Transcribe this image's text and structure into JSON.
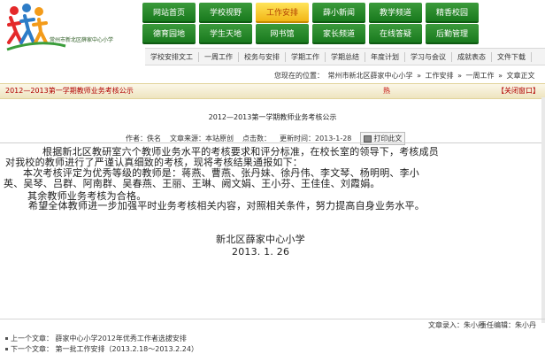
{
  "header": {
    "logo_text": "常州市新北区薛家中心小学",
    "nav_row1": [
      "网站首页",
      "学校视野",
      "工作安排",
      "薛小新闻",
      "教学频道",
      "精香校园"
    ],
    "nav_row1_active_index": 2,
    "nav_row2": [
      "德育园地",
      "学生天地",
      "网书馆",
      "家长频道",
      "在线答疑",
      "后勤管理"
    ],
    "subnav": [
      "学校安排文工",
      "一周工作",
      "校务与安排",
      "学期工作",
      "学期总结",
      "年度计划",
      "学习与会议",
      "成就表态",
      "文件下载"
    ]
  },
  "breadcrumb": {
    "prefix": "您现在的位置：",
    "items": [
      "常州市新北区薛家中心小学",
      "工作安排",
      "一周工作",
      "文章正文"
    ]
  },
  "titlebar": {
    "text": "2012—2013第一学期教师业务考核公示",
    "hot": "热",
    "close_label": "【关闭窗口】"
  },
  "article": {
    "title": "2012—2013第一学期教师业务考核公示",
    "meta": {
      "author": "作者：佚名",
      "source": "文章来源：本站原创",
      "hits": "点击数：",
      "updated": "更新时间：2013-1-28",
      "print_label": "打印此文"
    },
    "paragraphs": [
      "根据新北区教研室六个教师业务水平的考核要求和评分标准，在校长室的领导下，考核成员",
      "对我校的教师进行了严谨认真细致的考核，现将考核结果通报如下：",
      "本次考核评定为优秀等级的教师是：蒋燕、曹燕、张丹妹、徐丹伟、李文琴、杨明明、李小",
      "英、吴琴、吕群、阿南群、吴春燕、王丽、王琳、阙文娟、王小芬、王佳佳、刘霞娟。",
      "其余教师业务考核为合格。",
      "希望全体教师进一步加强平时业务考核相关内容，对照相关条件，努力提高自身业务水平。"
    ],
    "signature_org": "新北区薛家中心小学",
    "signature_date": "2013. 1. 26"
  },
  "footer": {
    "author_label": "文章录入：朱小丹",
    "editor_label": "责任编辑：朱小丹",
    "prev": "上一个文章：  薛家中心小学2012年优秀工作者选拔安排",
    "next": "下一个文章：  第一批工作安排（2013.2.18～2013.2.24）"
  },
  "colors": {
    "nav_green": "#197a1e",
    "nav_active": "#f2b616",
    "title_red": "#b00000"
  }
}
